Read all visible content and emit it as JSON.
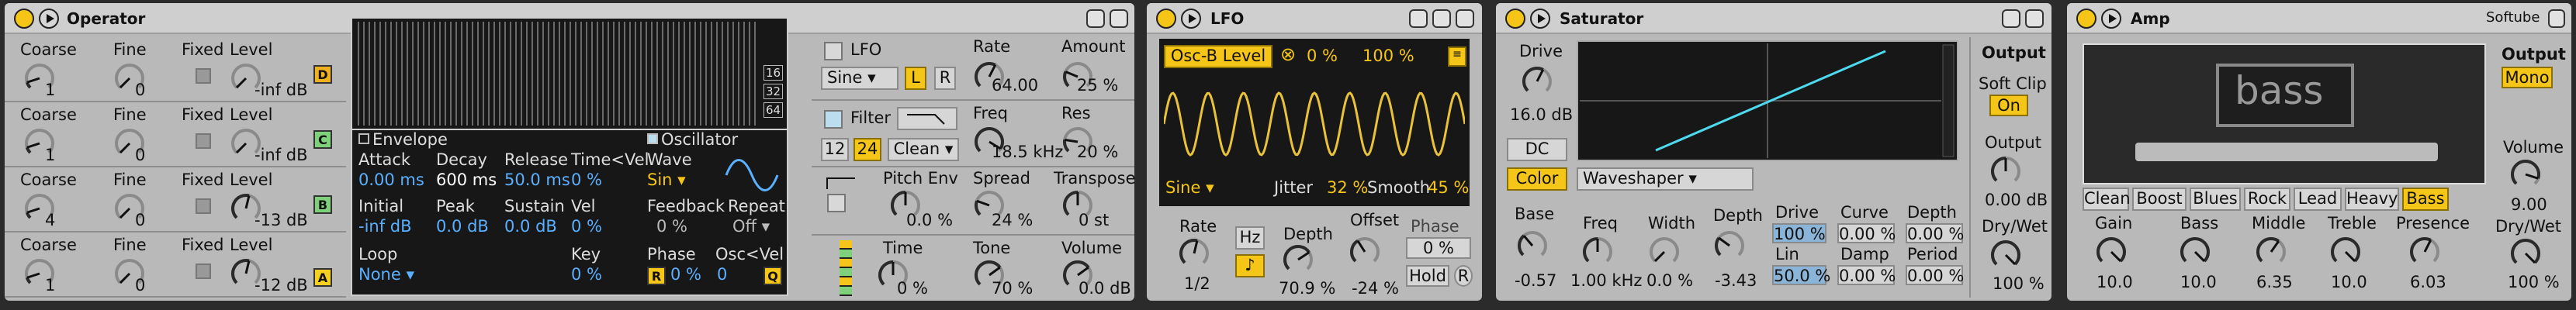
{
  "operator": {
    "title": "Operator",
    "ops": [
      {
        "coarse": "1",
        "fine": "0",
        "level": "-inf dB",
        "tag": "D",
        "tag_color": "#f0b020"
      },
      {
        "coarse": "1",
        "fine": "0",
        "level": "-inf dB",
        "tag": "C",
        "tag_color": "#7ed07a"
      },
      {
        "coarse": "4",
        "fine": "0",
        "level": "-13 dB",
        "tag": "B",
        "tag_color": "#7ed07a"
      },
      {
        "coarse": "1",
        "fine": "0",
        "level": "-12 dB",
        "tag": "A",
        "tag_color": "#f5d020"
      }
    ],
    "labels": {
      "coarse": "Coarse",
      "fine": "Fine",
      "fixed": "Fixed",
      "level": "Level"
    },
    "ruler": [
      "16",
      "32",
      "64"
    ],
    "envelope": {
      "title": "Envelope",
      "attack_l": "Attack",
      "attack": "0.00 ms",
      "decay_l": "Decay",
      "decay": "600 ms",
      "release_l": "Release",
      "release": "50.0 ms",
      "timevel_l": "Time<Vel",
      "timevel": "0 %",
      "initial_l": "Initial",
      "initial": "-inf dB",
      "peak_l": "Peak",
      "peak": "0.0 dB",
      "sustain_l": "Sustain",
      "sustain": "0.0 dB",
      "vel_l": "Vel",
      "vel": "0 %",
      "loop_l": "Loop",
      "loop": "None",
      "key_l": "Key",
      "key": "0 %"
    },
    "oscillator": {
      "title": "Oscillator",
      "wave_l": "Wave",
      "wave": "Sin",
      "feedback_l": "Feedback",
      "feedback": "0 %",
      "repeat_l": "Repeat",
      "repeat": "Off",
      "phase_l": "Phase",
      "phase": "0 %",
      "oscvel_l": "Osc<Vel",
      "oscvel": "0",
      "r": "R",
      "q": "Q"
    },
    "lfo": {
      "label": "LFO",
      "wave": "Sine",
      "l": "L",
      "r": "R",
      "rate_l": "Rate",
      "rate": "64.00",
      "amount_l": "Amount",
      "amount": "25 %"
    },
    "filter": {
      "label": "Filter",
      "slope1": "12",
      "slope2": "24",
      "mode": "Clean",
      "freq_l": "Freq",
      "freq": "18.5 kHz",
      "res_l": "Res",
      "res": "20 %"
    },
    "pitch": {
      "label": "Pitch Env",
      "value": "0.0 %",
      "spread_l": "Spread",
      "spread": "24 %",
      "transpose_l": "Transpose",
      "transpose": "0 st"
    },
    "global": {
      "time_l": "Time",
      "time": "0 %",
      "tone_l": "Tone",
      "tone": "70 %",
      "volume_l": "Volume",
      "volume": "0.0 dB"
    }
  },
  "lfo_dev": {
    "title": "LFO",
    "map_target": "Osc-B Level",
    "x": "⊗",
    "map_amount": "0 %",
    "map_amount2": "100 %",
    "wave": "Sine",
    "jitter_l": "Jitter",
    "jitter": "32 %",
    "smooth_l": "Smooth",
    "smooth": "45 %",
    "rate_l": "Rate",
    "rate": "1/2",
    "hz": "Hz",
    "note": "♪",
    "depth_l": "Depth",
    "depth": "70.9 %",
    "offset_l": "Offset",
    "offset": "-24 %",
    "phase_l": "Phase",
    "phase": "0 %",
    "hold": "Hold",
    "r": "R"
  },
  "saturator": {
    "title": "Saturator",
    "drive_l": "Drive",
    "drive": "16.0 dB",
    "dc": "DC",
    "color": "Color",
    "type": "Waveshaper",
    "base_l": "Base",
    "base": "-0.57",
    "freq_l": "Freq",
    "freq": "1.00 kHz",
    "width_l": "Width",
    "width": "0.0 %",
    "depth_l": "Depth",
    "depth": "-3.43",
    "ws": {
      "drive_l": "Drive",
      "drive": "100 %",
      "curve_l": "Curve",
      "curve": "0.00 %",
      "depth_l": "Depth",
      "depth": "0.00 %",
      "lin_l": "Lin",
      "lin": "50.0 %",
      "damp_l": "Damp",
      "damp": "0.00 %",
      "period_l": "Period",
      "period": "0.00 %"
    },
    "output_title": "Output",
    "softclip_l": "Soft Clip",
    "softclip": "On",
    "output_l": "Output",
    "output": "0.00 dB",
    "drywet_l": "Dry/Wet",
    "drywet": "100 %"
  },
  "amp": {
    "title": "Amp",
    "brand": "Softube",
    "model": "bass",
    "types": [
      "Clean",
      "Boost",
      "Blues",
      "Rock",
      "Lead",
      "Heavy",
      "Bass"
    ],
    "active_type": "Bass",
    "gain_l": "Gain",
    "gain": "10.0",
    "bass_l": "Bass",
    "bass": "10.0",
    "middle_l": "Middle",
    "middle": "6.35",
    "treble_l": "Treble",
    "treble": "10.0",
    "presence_l": "Presence",
    "presence": "6.03",
    "output_l": "Output",
    "mono": "Mono",
    "volume_l": "Volume",
    "volume": "9.00",
    "drywet_l": "Dry/Wet",
    "drywet": "100 %"
  }
}
